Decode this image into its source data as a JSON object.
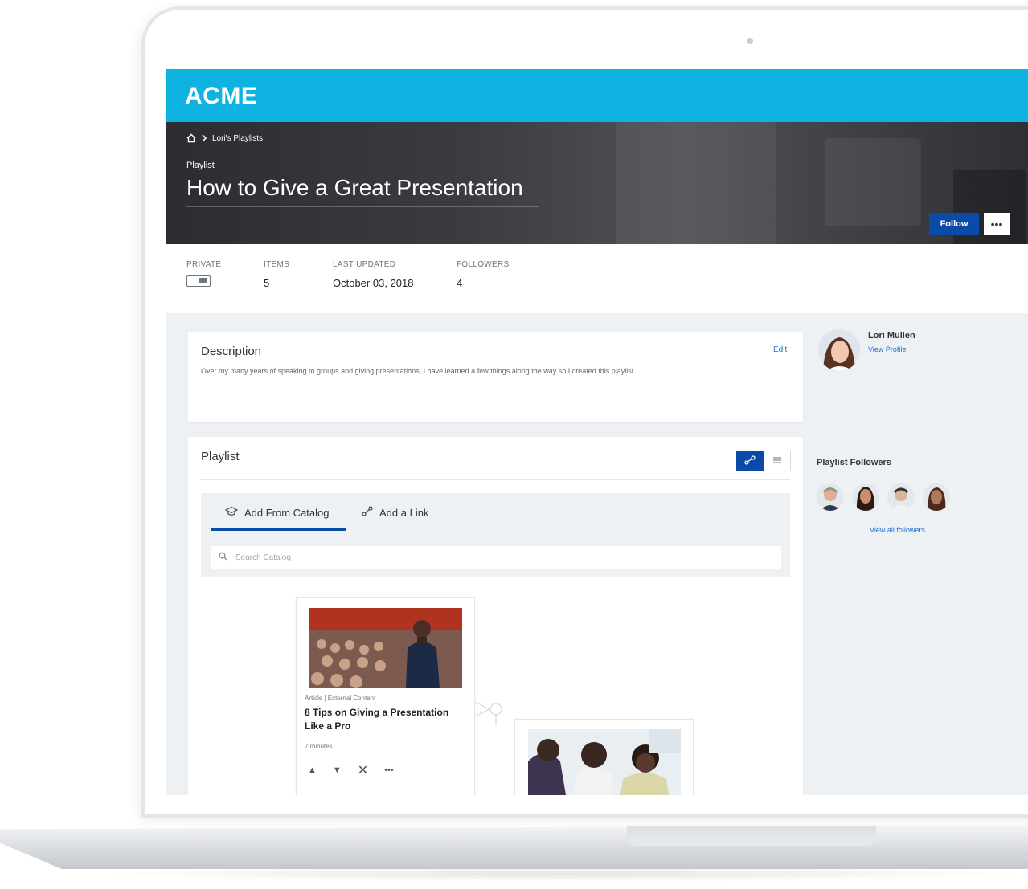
{
  "brand": "ACME",
  "breadcrumb": {
    "current": "Lori's Playlists"
  },
  "hero": {
    "kicker": "Playlist",
    "title": "How to Give a Great Presentation"
  },
  "actions": {
    "follow_label": "Follow",
    "more_label": "•••"
  },
  "stats": {
    "private_label": "PRIVATE",
    "items_label": "ITEMS",
    "items_value": "5",
    "updated_label": "LAST UPDATED",
    "updated_value": "October 03, 2018",
    "followers_label": "FOLLOWERS",
    "followers_value": "4"
  },
  "description": {
    "title": "Description",
    "edit_label": "Edit",
    "text": "Over my many years of speaking to groups and giving presentations, I have learned a few things along the way so I created this playlist."
  },
  "playlist": {
    "title": "Playlist",
    "tabs": {
      "catalog": "Add From Catalog",
      "link": "Add a Link"
    },
    "search_placeholder": "Search Catalog",
    "items": [
      {
        "meta": "Article | External Content",
        "title": "8 Tips on Giving a Presentation Like a Pro",
        "duration": "7 minutes"
      }
    ]
  },
  "profile": {
    "name": "Lori Mullen",
    "link": "View Profile"
  },
  "followers": {
    "title": "Playlist Followers",
    "link": "View all followers"
  },
  "colors": {
    "topbar": "#0fb3e1",
    "primary": "#0c4aa8",
    "link": "#1f6fd0"
  }
}
